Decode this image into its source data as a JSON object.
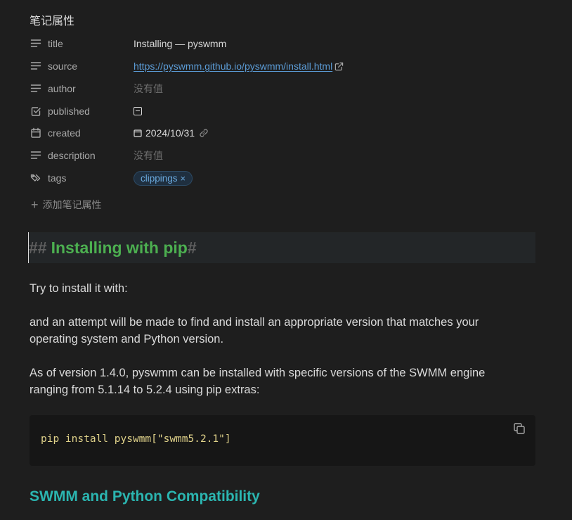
{
  "properties": {
    "heading": "笔记属性",
    "title": {
      "key": "title",
      "value": "Installing — pyswmm"
    },
    "source": {
      "key": "source",
      "value": "https://pyswmm.github.io/pyswmm/install.html"
    },
    "author": {
      "key": "author",
      "value": "没有值"
    },
    "published": {
      "key": "published",
      "checked": "indeterminate"
    },
    "created": {
      "key": "created",
      "value": "2024/10/31"
    },
    "description": {
      "key": "description",
      "value": "没有值"
    },
    "tags": {
      "key": "tags",
      "items": [
        "clippings"
      ],
      "remove_glyph": "×"
    },
    "add_label": "添加笔记属性",
    "add_glyph": "+"
  },
  "content": {
    "h2": {
      "marker_left": "##",
      "text": "Installing with pip",
      "marker_right": "#"
    },
    "p1": "Try to install it with:",
    "p2": "and an attempt will be made to find and install an appropriate version that matches your operating system and Python version.",
    "p3": "As of version 1.4.0, pyswmm can be installed with specific versions of the SWMM engine ranging from 5.1.14 to 5.2.4 using pip extras:",
    "code": "pip install pyswmm[\"swmm5.2.1\"]",
    "h3": "SWMM and Python Compatibility"
  },
  "colors": {
    "background": "#1e1e1e",
    "h2": "#4caf50",
    "h3": "#2bb5b0",
    "link": "#5b9bd5",
    "tag": "#6aa9dd"
  },
  "icons": {
    "text_property": "lines-icon",
    "checkbox_property": "checkbox-icon",
    "date_property": "calendar-icon",
    "tags_property": "tags-icon",
    "external_link": "external-link-icon",
    "link": "link-icon",
    "copy": "copy-icon"
  }
}
